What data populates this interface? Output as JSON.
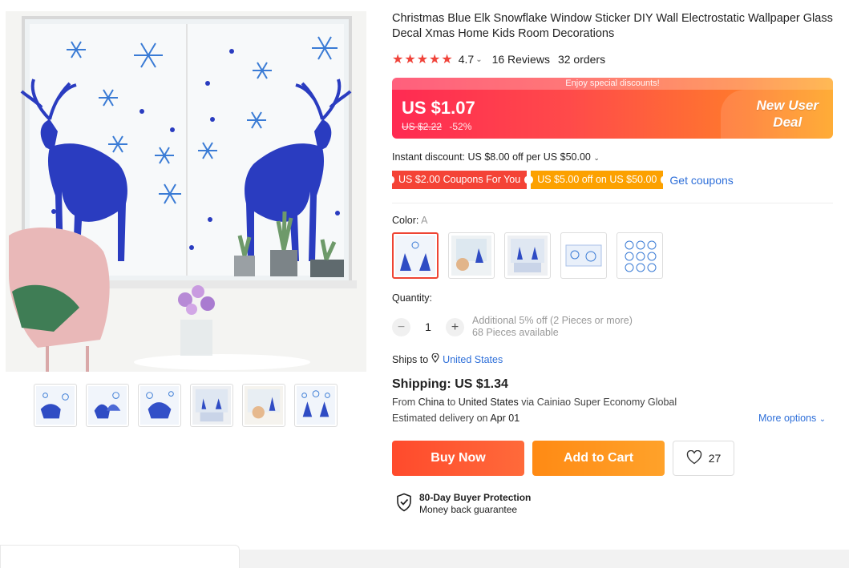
{
  "product": {
    "title": "Christmas Blue Elk Snowflake Window Sticker DIY Wall Electrostatic Wallpaper Glass Decal Xmas Home Kids Room Decorations",
    "rating": "4.7",
    "stars": "★★★★★",
    "reviews": "16 Reviews",
    "orders": "32 orders"
  },
  "price": {
    "banner_strip": "Enjoy special discounts!",
    "current": "US $1.07",
    "original": "US $2.22",
    "discount": "-52%",
    "deal_line1": "New User",
    "deal_line2": "Deal"
  },
  "discounts": {
    "instant": "Instant discount: US $8.00 off per US $50.00",
    "coupon1": "US $2.00 Coupons For You",
    "coupon2": "US $5.00 off on US $50.00",
    "get_coupons": "Get coupons"
  },
  "variant": {
    "label": "Color:",
    "selected": "A"
  },
  "quantity": {
    "label": "Quantity:",
    "minus": "−",
    "value": "1",
    "plus": "+",
    "info1": "Additional 5% off (2 Pieces or more)",
    "info2": "68 Pieces available"
  },
  "shipping": {
    "ships_to_label": "Ships to",
    "country": "United States",
    "price": "Shipping: US $1.34",
    "from_prefix": "From",
    "from_country": "China",
    "to_word": "to",
    "to_country": "United States",
    "via": "via Cainiao Super Economy Global",
    "delivery_prefix": "Estimated delivery on",
    "delivery_date": "Apr 01",
    "more_options": "More options"
  },
  "actions": {
    "buy_now": "Buy Now",
    "add_to_cart": "Add to Cart",
    "wishlist_count": "27"
  },
  "protection": {
    "title": "80-Day Buyer Protection",
    "subtitle": "Money back guarantee"
  },
  "colors": {
    "price_red": "#ff2a52",
    "price_orange": "#ffa21c",
    "link_blue": "#2e6fd9",
    "star_red": "#f0433a",
    "buy_red": "#ff4a2c",
    "cart_orange": "#ff8a14"
  }
}
